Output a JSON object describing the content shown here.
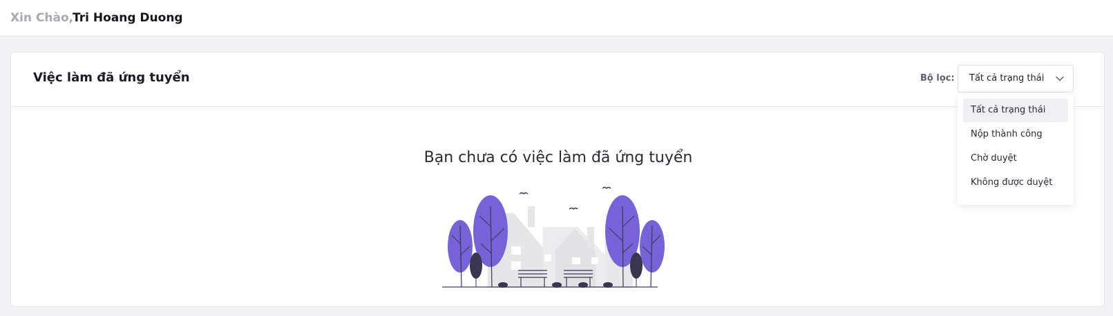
{
  "header": {
    "greeting": "Xin Chào,",
    "user_name": "Tri Hoang Duong"
  },
  "card": {
    "title": "Việc làm đã ứng tuyển",
    "filter": {
      "label": "Bộ lọc:",
      "selected": "Tất cả trạng thái",
      "options": [
        "Tất cả trạng thái",
        "Nộp thành công",
        "Chờ duyệt",
        "Không được duyệt"
      ]
    },
    "empty_message": "Bạn chưa có việc làm đã ứng tuyển"
  },
  "colors": {
    "accent_purple": "#7762d8",
    "dark_shrub": "#3b3650",
    "building_gray": "#e6e6e8"
  },
  "icons": {
    "select_chevron": "chevron-down-icon",
    "illustration": "empty-state-illustration"
  }
}
